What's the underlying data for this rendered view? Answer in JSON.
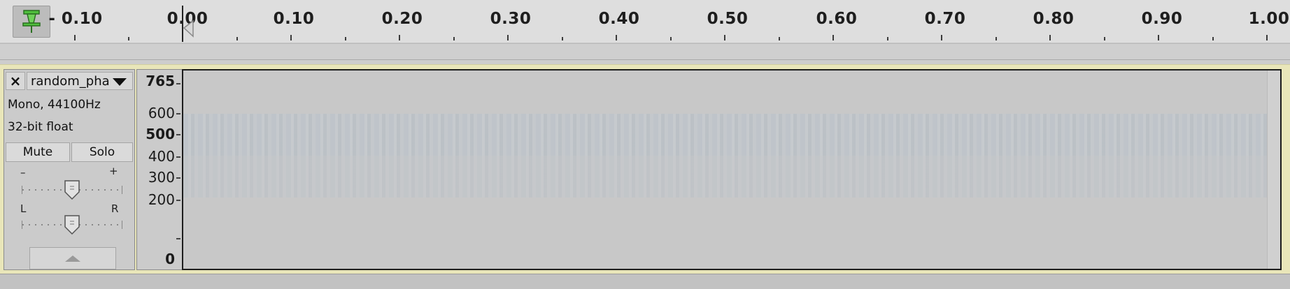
{
  "timeline": {
    "ticks": [
      "- 0.10",
      "0.00",
      "0.10",
      "0.20",
      "0.30",
      "0.40",
      "0.50",
      "0.60",
      "0.70",
      "0.80",
      "0.90",
      "1.00"
    ],
    "pin_icon_color": "#4fbf3d"
  },
  "track": {
    "close_label": "×",
    "name": "random_pha",
    "info_channels": "Mono, 44100Hz",
    "info_format": "32-bit float",
    "mute_label": "Mute",
    "solo_label": "Solo",
    "gain_minus": "–",
    "gain_plus": "+",
    "pan_left": "L",
    "pan_right": "R",
    "gain_level": 0.5,
    "pan_level": 0.5,
    "track_color": "#e9e6b9"
  },
  "vertical_ruler": {
    "labels": [
      "765",
      "600",
      "500",
      "400",
      "300",
      "200",
      "0"
    ]
  }
}
